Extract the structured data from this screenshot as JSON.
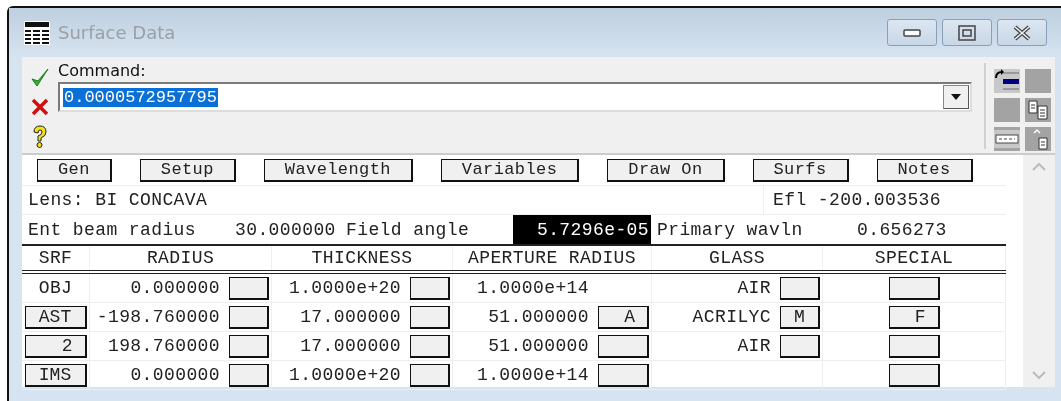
{
  "window": {
    "title": "Surface Data"
  },
  "command": {
    "label": "Command:",
    "value": "0.0000572957795",
    "selected": true
  },
  "toolbar_buttons": [
    "Gen",
    "Setup",
    "Wavelength",
    "Variables",
    "Draw On",
    "Surfs",
    "Notes"
  ],
  "lens": {
    "text": "Lens: BI CONCAVA",
    "efl": "Efl -200.003536"
  },
  "system": {
    "ent_beam_label": "Ent beam radius",
    "ent_beam": "30.000000",
    "field_label": "Field angle",
    "field": {
      "value": "5.7296e-05",
      "selected": true
    },
    "wavln_label": "Primary wavln",
    "wavln": "0.656273"
  },
  "table": {
    "columns": [
      "SRF",
      "RADIUS",
      "THICKNESS",
      "APERTURE RADIUS",
      "GLASS",
      "SPECIAL"
    ],
    "rows": [
      {
        "srf": {
          "text": "OBJ",
          "kind": "label"
        },
        "radius": {
          "value": "0.000000",
          "button": true
        },
        "thickness": {
          "value": "1.0000e+20",
          "button": true
        },
        "aperture": {
          "value": "1.0000e+14",
          "button": false
        },
        "glass": {
          "value": "AIR",
          "button": true
        },
        "special": {
          "button": true
        }
      },
      {
        "srf": {
          "text": "AST",
          "kind": "button"
        },
        "radius": {
          "value": "-198.760000",
          "button": true
        },
        "thickness": {
          "value": "17.000000",
          "button": true
        },
        "aperture": {
          "value": "51.000000",
          "button": true,
          "flag": "A"
        },
        "glass": {
          "value": "ACRILYC",
          "button": true,
          "flag": "M"
        },
        "special": {
          "button": true,
          "flag": "F"
        }
      },
      {
        "srf": {
          "text": "2",
          "kind": "button"
        },
        "radius": {
          "value": "198.760000",
          "button": true
        },
        "thickness": {
          "value": "17.000000",
          "button": true
        },
        "aperture": {
          "value": "51.000000",
          "button": true
        },
        "glass": {
          "value": "AIR",
          "button": true
        },
        "special": {
          "button": true
        }
      },
      {
        "srf": {
          "text": "IMS",
          "kind": "button"
        },
        "radius": {
          "value": "0.000000",
          "button": true
        },
        "thickness": {
          "value": "1.0000e+20",
          "button": true
        },
        "aperture": {
          "value": "1.0000e+14",
          "button": true
        },
        "glass": {
          "button": false
        },
        "special": {
          "button": true
        }
      }
    ]
  }
}
